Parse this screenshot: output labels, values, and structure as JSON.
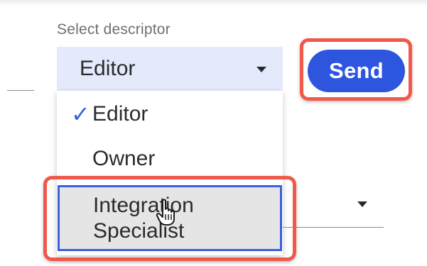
{
  "select_field": {
    "label": "Select descriptor",
    "value": "Editor"
  },
  "send_button": {
    "label": "Send",
    "color": "#2d55de"
  },
  "dropdown": {
    "options": [
      {
        "label": "Editor",
        "selected": true
      },
      {
        "label": "Owner",
        "selected": false
      },
      {
        "label": "Integration Specialist",
        "line1": "Integration",
        "line2": "Specialist",
        "hovered": true
      }
    ],
    "check_glyph": "✓"
  },
  "colors": {
    "highlight": "#f0584a",
    "select_bg": "#e4e9fb",
    "accent": "#3a5fe0"
  },
  "icons": {
    "dropdown_caret": "caret-down-icon",
    "cursor": "hand-pointer-icon",
    "check": "check-icon"
  }
}
